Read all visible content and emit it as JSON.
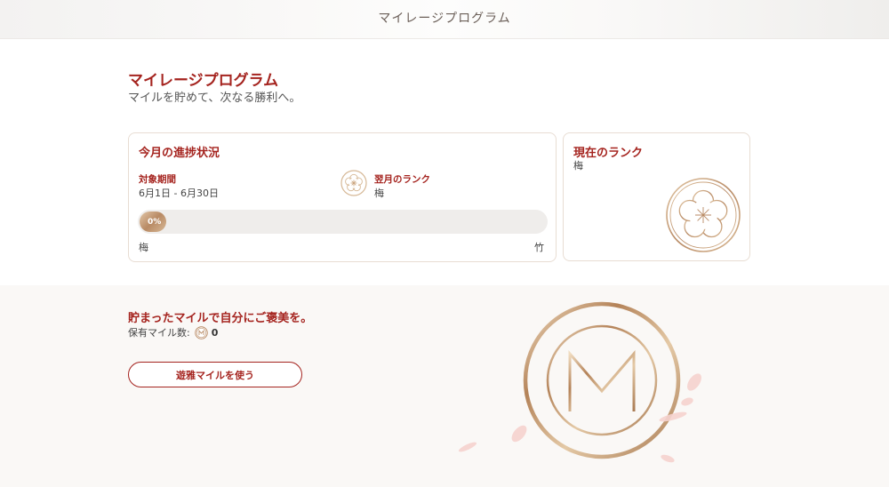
{
  "header": {
    "title": "マイレージプログラム"
  },
  "hero": {
    "title": "マイレージプログラム",
    "subtitle": "マイルを貯めて、次なる勝利へ。"
  },
  "progress_card": {
    "title": "今月の進捗状況",
    "period_label": "対象期間",
    "period_value": "6月1日 - 6月30日",
    "next_rank_label": "翌月のランク",
    "next_rank_value": "梅",
    "progress_percent": 0,
    "progress_text": "0%",
    "scale_start": "梅",
    "scale_end": "竹"
  },
  "rank_card": {
    "title": "現在のランク",
    "rank_value": "梅"
  },
  "rewards": {
    "title": "貯まったマイルで自分にご褒美を。",
    "miles_label": "保有マイル数:",
    "miles_count": "0",
    "button_label": "遊雅マイルを使う"
  },
  "colors": {
    "accent": "#a5241f",
    "gold": "#b88a64",
    "band_bg": "#faf8f6",
    "petal": "#f4c9c6"
  },
  "icons": {
    "next_rank": "plum-blossom-icon",
    "current_rank": "plum-blossom-emblem",
    "miles": "mileage-m-icon",
    "hero_emblem": "mileage-m-emblem"
  }
}
